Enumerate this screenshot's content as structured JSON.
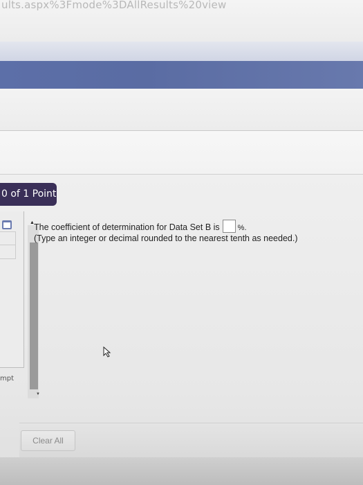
{
  "browser": {
    "url_fragment": "ults.aspx%3Fmode%3DAllResults%20view"
  },
  "question": {
    "points_label": "0 of 1 Point",
    "prompt": "The coefficient of determination for Data Set B is",
    "answer_value": "",
    "unit": "%.",
    "instruction": "(Type an integer or decimal rounded to the nearest tenth as needed.)"
  },
  "left_panel": {
    "attempt_label": "mpt"
  },
  "footer": {
    "clear_all_label": "Clear All"
  },
  "colors": {
    "header_blue": "#5c6fa8",
    "badge_bg": "#3a2f58"
  },
  "icons": [
    "note-icon",
    "scroll-up-icon",
    "scroll-down-icon",
    "cursor-icon"
  ]
}
